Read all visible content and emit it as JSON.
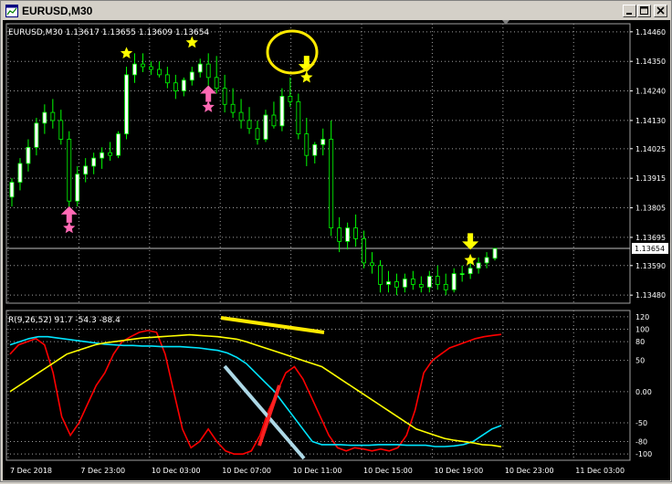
{
  "window": {
    "title": "EURUSD,M30",
    "controls": [
      "minimize",
      "maximize",
      "close"
    ]
  },
  "chart": {
    "header": "EURUSD,M30  1.13617 1.13655 1.13609 1.13654",
    "indicator_label": "R(9,26,52) 91.7 -54.3 -88.4",
    "current_price": "1.13654",
    "price_ticks": [
      "1.14460",
      "1.14350",
      "1.14240",
      "1.14130",
      "1.14025",
      "1.13915",
      "1.13805",
      "1.13695",
      "1.13590",
      "1.13480"
    ],
    "indicator_ticks": [
      "120",
      "100",
      "80",
      "50",
      "0.00",
      "-50",
      "-80",
      "-100"
    ],
    "time_labels": [
      "7 Dec 2018",
      "7 Dec 23:00",
      "10 Dec 03:00",
      "10 Dec 07:00",
      "10 Dec 11:00",
      "10 Dec 15:00",
      "10 Dec 19:00",
      "10 Dec 23:00",
      "11 Dec 03:00"
    ]
  },
  "colors": {
    "background": "#000000",
    "grid": "#a0a0a0",
    "bull_candle": "#ffffff",
    "bear_candle": "#000000",
    "wick": "#00ff00",
    "series_red": "#ff0000",
    "series_cyan": "#00e5ff",
    "series_yellow": "#ffff00",
    "star": "#ffff00",
    "pink_arrow": "#ff69b4",
    "annotation_light_blue": "#add8e6"
  },
  "chart_data": {
    "type": "candlestick",
    "symbol": "EURUSD",
    "timeframe": "M30",
    "ohlc": [
      [
        1.13845,
        1.13915,
        1.1381,
        1.139
      ],
      [
        1.139,
        1.1399,
        1.1387,
        1.1397
      ],
      [
        1.1397,
        1.1406,
        1.1394,
        1.1403
      ],
      [
        1.1403,
        1.1414,
        1.14,
        1.1412
      ],
      [
        1.1412,
        1.1419,
        1.1408,
        1.1416
      ],
      [
        1.1416,
        1.1421,
        1.141,
        1.1413
      ],
      [
        1.1413,
        1.1417,
        1.1404,
        1.1406
      ],
      [
        1.1406,
        1.1409,
        1.1379,
        1.1383
      ],
      [
        1.1383,
        1.1396,
        1.1381,
        1.1393
      ],
      [
        1.1393,
        1.1399,
        1.139,
        1.1396
      ],
      [
        1.1396,
        1.1401,
        1.1393,
        1.1399
      ],
      [
        1.1399,
        1.1403,
        1.1395,
        1.1401
      ],
      [
        1.1401,
        1.1405,
        1.1398,
        1.14
      ],
      [
        1.14,
        1.1409,
        1.1399,
        1.1408
      ],
      [
        1.1408,
        1.1433,
        1.1406,
        1.143
      ],
      [
        1.143,
        1.1438,
        1.1427,
        1.1434
      ],
      [
        1.1434,
        1.1438,
        1.1431,
        1.1433
      ],
      [
        1.1433,
        1.1435,
        1.143,
        1.1432
      ],
      [
        1.1432,
        1.1435,
        1.1429,
        1.143
      ],
      [
        1.143,
        1.1433,
        1.1425,
        1.1427
      ],
      [
        1.1427,
        1.143,
        1.1421,
        1.1424
      ],
      [
        1.1424,
        1.1429,
        1.1422,
        1.1428
      ],
      [
        1.1428,
        1.1433,
        1.1426,
        1.1431
      ],
      [
        1.1431,
        1.1436,
        1.1429,
        1.1434
      ],
      [
        1.1434,
        1.1438,
        1.1426,
        1.1429
      ],
      [
        1.1429,
        1.1437,
        1.1423,
        1.1425
      ],
      [
        1.1425,
        1.143,
        1.1416,
        1.1419
      ],
      [
        1.1419,
        1.1425,
        1.1414,
        1.1416
      ],
      [
        1.1416,
        1.1421,
        1.141,
        1.1413
      ],
      [
        1.1413,
        1.1418,
        1.1408,
        1.141
      ],
      [
        1.141,
        1.1413,
        1.1404,
        1.1406
      ],
      [
        1.1406,
        1.1417,
        1.1405,
        1.1415
      ],
      [
        1.1415,
        1.142,
        1.141,
        1.1411
      ],
      [
        1.1411,
        1.1425,
        1.1409,
        1.1422
      ],
      [
        1.1422,
        1.1429,
        1.1418,
        1.142
      ],
      [
        1.142,
        1.1423,
        1.1406,
        1.1408
      ],
      [
        1.1408,
        1.1414,
        1.1396,
        1.14
      ],
      [
        1.14,
        1.1405,
        1.1397,
        1.1404
      ],
      [
        1.1404,
        1.141,
        1.14,
        1.1406
      ],
      [
        1.1406,
        1.1413,
        1.137,
        1.1373
      ],
      [
        1.1373,
        1.1377,
        1.1364,
        1.1368
      ],
      [
        1.1368,
        1.1375,
        1.1365,
        1.1373
      ],
      [
        1.1373,
        1.1378,
        1.1366,
        1.1369
      ],
      [
        1.1369,
        1.1372,
        1.1358,
        1.136
      ],
      [
        1.136,
        1.1364,
        1.1356,
        1.1359
      ],
      [
        1.1359,
        1.1361,
        1.1349,
        1.1352
      ],
      [
        1.1352,
        1.1357,
        1.1349,
        1.1353
      ],
      [
        1.1353,
        1.1356,
        1.1348,
        1.1351
      ],
      [
        1.1351,
        1.1356,
        1.1349,
        1.1354
      ],
      [
        1.1354,
        1.1357,
        1.135,
        1.1352
      ],
      [
        1.1352,
        1.1355,
        1.1349,
        1.1351
      ],
      [
        1.1351,
        1.1357,
        1.1349,
        1.1355
      ],
      [
        1.1355,
        1.1359,
        1.135,
        1.1352
      ],
      [
        1.1352,
        1.1356,
        1.1348,
        1.135
      ],
      [
        1.135,
        1.1358,
        1.1349,
        1.1356
      ],
      [
        1.1356,
        1.1359,
        1.1353,
        1.1356
      ],
      [
        1.1356,
        1.136,
        1.1354,
        1.1358
      ],
      [
        1.1358,
        1.1362,
        1.1356,
        1.136
      ],
      [
        1.136,
        1.1364,
        1.1358,
        1.1362
      ],
      [
        1.13617,
        1.13655,
        1.13609,
        1.13654
      ]
    ],
    "price_axis": {
      "range": [
        1.1345,
        1.1449
      ]
    },
    "indicator": {
      "label": "R(9,26,52)",
      "range": [
        -110,
        130
      ],
      "series": [
        {
          "color": "#ff0000",
          "values": [
            60,
            75,
            80,
            85,
            75,
            30,
            -40,
            -70,
            -50,
            -20,
            10,
            30,
            60,
            80,
            88,
            95,
            98,
            95,
            60,
            0,
            -60,
            -90,
            -80,
            -60,
            -80,
            -95,
            -100,
            -100,
            -95,
            -70,
            -30,
            0,
            30,
            40,
            20,
            -10,
            -40,
            -70,
            -90,
            -95,
            -90,
            -92,
            -95,
            -92,
            -95,
            -90,
            -70,
            -30,
            30,
            50,
            60,
            70,
            75,
            80,
            85,
            88,
            90,
            91.7
          ]
        },
        {
          "color": "#00e5ff",
          "values": [
            75,
            80,
            85,
            88,
            88,
            86,
            84,
            82,
            80,
            78,
            76,
            75,
            74,
            74,
            73,
            73,
            72,
            72,
            72,
            71,
            70,
            68,
            66,
            62,
            55,
            45,
            30,
            15,
            0,
            -20,
            -40,
            -60,
            -80,
            -85,
            -85,
            -85,
            -86,
            -86,
            -86,
            -85,
            -85,
            -85,
            -86,
            -86,
            -86,
            -88,
            -88,
            -87,
            -85,
            -80,
            -70,
            -60,
            -54.3
          ]
        },
        {
          "color": "#ffff00",
          "values": [
            0,
            10,
            20,
            30,
            40,
            50,
            60,
            65,
            70,
            75,
            78,
            80,
            82,
            84,
            86,
            87,
            88,
            89,
            90,
            91,
            90,
            89,
            88,
            86,
            84,
            80,
            75,
            70,
            65,
            60,
            55,
            50,
            45,
            40,
            30,
            20,
            10,
            0,
            -10,
            -20,
            -30,
            -40,
            -50,
            -60,
            -65,
            -70,
            -75,
            -78,
            -80,
            -82,
            -85,
            -86,
            -88.4
          ]
        }
      ]
    },
    "markers": [
      {
        "type": "star",
        "candle": 7,
        "price": 1.1373,
        "color": "#ff69b4"
      },
      {
        "type": "up-arrow",
        "candle": 7,
        "price": 1.1378,
        "color": "#ff69b4"
      },
      {
        "type": "star",
        "candle": 14,
        "price": 1.1438,
        "color": "#ffff00"
      },
      {
        "type": "star",
        "candle": 22,
        "price": 1.1442,
        "color": "#ffff00"
      },
      {
        "type": "star",
        "candle": 24,
        "price": 1.1418,
        "color": "#ff69b4"
      },
      {
        "type": "up-arrow",
        "candle": 24,
        "price": 1.1423,
        "color": "#ff69b4"
      },
      {
        "type": "star",
        "candle": 36,
        "price": 1.1429,
        "color": "#ffff00"
      },
      {
        "type": "down-arrow",
        "candle": 36,
        "price": 1.1434,
        "color": "#ffff00"
      },
      {
        "type": "star",
        "candle": 56,
        "price": 1.1361,
        "color": "#ffff00"
      },
      {
        "type": "down-arrow",
        "candle": 56,
        "price": 1.1368,
        "color": "#ffff00"
      }
    ]
  }
}
